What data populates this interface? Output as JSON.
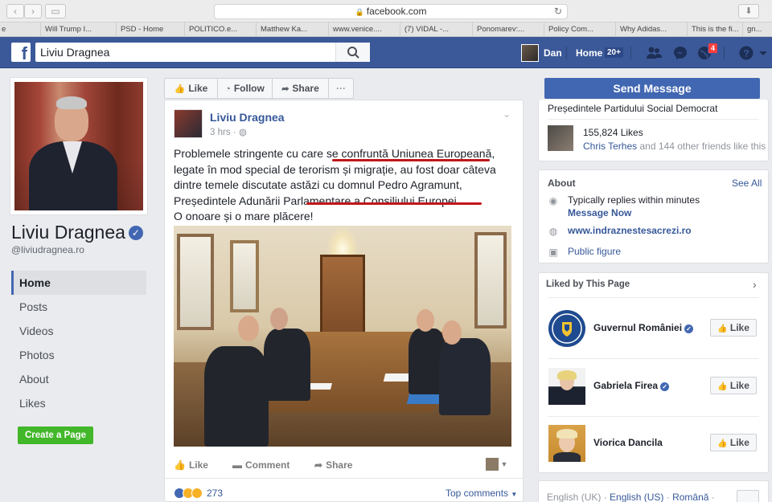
{
  "browser": {
    "url": "facebook.com",
    "bookmarks": [
      "Will Trump I...",
      "PSD - Home",
      "POLITICO.e...",
      "Matthew Ka...",
      "www.venice....",
      "(7) VIDAL -...",
      "Ponomarev:...",
      "Policy Com...",
      "Why Adidas...",
      "This is the fi...",
      "gn..."
    ],
    "bookmark_left_partial": "e"
  },
  "topbar": {
    "search_value": "Liviu Dragnea",
    "user_name": "Dan",
    "home_label": "Home",
    "home_count": "20+",
    "notifications_count": "4"
  },
  "page": {
    "name": "Liviu Dragnea",
    "handle": "@liviudragnea.ro",
    "nav": [
      "Home",
      "Posts",
      "Videos",
      "Photos",
      "About",
      "Likes"
    ],
    "active_nav": "Home",
    "create_page_label": "Create a Page"
  },
  "actions": {
    "like": "Like",
    "follow": "Follow",
    "share": "Share",
    "more": "···",
    "send_message": "Send Message"
  },
  "post": {
    "author": "Liviu Dragnea",
    "time": "3 hrs",
    "text_lines": [
      "Problemele stringente cu care se confruntă Uniunea Europeană,",
      "legate în mod special de terorism și migrație, au fost doar câteva",
      "dintre temele discutate astăzi cu domnul Pedro Agramunt,",
      "Președintele Adunării Parlamentare a Consiliului Europei.",
      "O onoare și o mare plăcere!"
    ],
    "like_label": "Like",
    "comment_label": "Comment",
    "share_label": "Share",
    "reaction_count": "273",
    "top_comments_label": "Top comments"
  },
  "right": {
    "party_text": "Președintele Partidului Social Democrat",
    "likes_count": "155,824 Likes",
    "friend_name": "Chris Terhes",
    "friends_rest": "and 144 other friends like this",
    "about_title": "About",
    "see_all": "See All",
    "reply_text": "Typically replies within minutes",
    "message_now": "Message Now",
    "website": "www.indraznestesacrezi.ro",
    "category": "Public figure",
    "liked_title": "Liked by This Page",
    "liked_pages": [
      {
        "name": "Guvernul României",
        "verified": true,
        "button": "Like"
      },
      {
        "name": "Gabriela Firea",
        "verified": true,
        "button": "Like"
      },
      {
        "name": "Viorica Dancila",
        "verified": false,
        "button": "Like"
      }
    ],
    "footer_lang_1": "English (UK)",
    "footer_lang_2": "English (US)",
    "footer_lang_3": "Română"
  },
  "colors": {
    "fb_blue": "#3b5998",
    "link": "#365899",
    "button_blue": "#4267b2",
    "green": "#42b72a",
    "underline_red": "#c0161a"
  }
}
